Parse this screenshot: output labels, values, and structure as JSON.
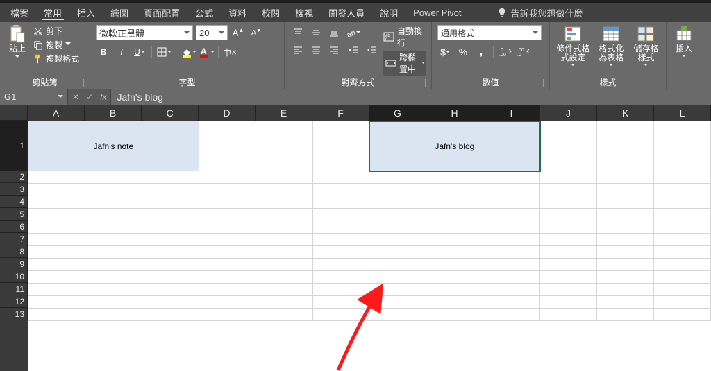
{
  "tabs": {
    "file": "檔案",
    "home": "常用",
    "insert": "插入",
    "draw": "繪圖",
    "pagelayout": "頁面配置",
    "formulas": "公式",
    "data": "資料",
    "review": "校閱",
    "view": "檢視",
    "developer": "開發人員",
    "help": "說明",
    "powerpivot": "Power Pivot"
  },
  "tellme": "告訴我您想做什麼",
  "ribbon": {
    "clipboard": {
      "paste": "貼上",
      "cut": "剪下",
      "copy": "複製",
      "formatpainter": "複製格式",
      "label": "剪貼簿"
    },
    "font": {
      "name": "微軟正黑體",
      "size": "20",
      "label": "字型",
      "phonetic": "中"
    },
    "alignment": {
      "wrap": "自動換行",
      "merge": "跨欄置中",
      "label": "對齊方式"
    },
    "number": {
      "format": "通用格式",
      "label": "數值"
    },
    "styles": {
      "cond": "條件式格式設定",
      "fmttable": "格式化為表格",
      "cellstyles": "儲存格樣式",
      "label": "樣式"
    },
    "cells": {
      "insert": "插入",
      "label": ""
    }
  },
  "formula_bar": {
    "namebox": "G1",
    "formula": "Jafn's blog"
  },
  "sheet": {
    "columns": [
      "A",
      "B",
      "C",
      "D",
      "E",
      "F",
      "G",
      "H",
      "I",
      "J",
      "K",
      "L"
    ],
    "rows": [
      "1",
      "2",
      "3",
      "4",
      "5",
      "6",
      "7",
      "8",
      "9",
      "10",
      "11",
      "12",
      "13"
    ],
    "cell_note": "Jafn's note",
    "cell_blog": "Jafn's blog",
    "selected_cols": [
      "G",
      "H",
      "I"
    ],
    "selected_row": "1"
  }
}
